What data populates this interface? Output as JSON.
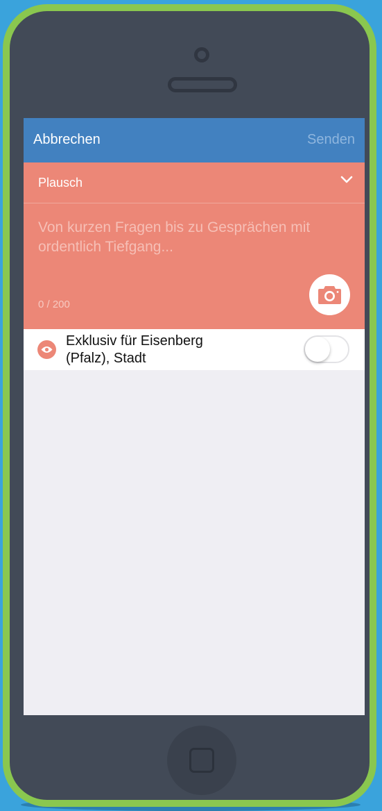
{
  "navbar": {
    "cancel_label": "Abbrechen",
    "send_label": "Senden",
    "background": "#4281c0"
  },
  "compose": {
    "category_label": "Plausch",
    "category_icon": "chevron-down-icon",
    "placeholder": "Von kurzen Fragen bis zu Gesprächen mit ordentlich Tiefgang...",
    "counter": "0 / 200",
    "camera_icon": "camera-icon",
    "background": "#ec8777"
  },
  "exclusive": {
    "icon": "eye-icon",
    "label": "Exklusiv für Eisenberg (Pfalz), Stadt",
    "toggle_on": false
  },
  "device": {
    "frame_color": "#8ac74f",
    "body_color": "#424a57",
    "background": "#3aa3dc"
  }
}
